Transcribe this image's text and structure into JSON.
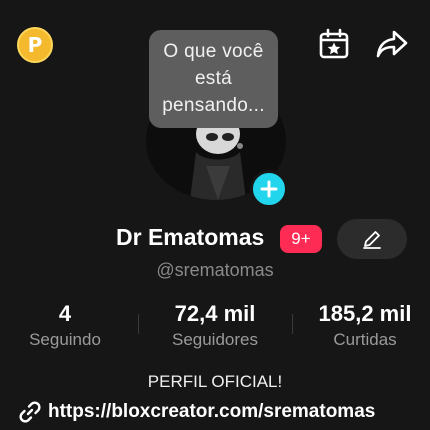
{
  "header": {
    "coin_letter": "P",
    "icons": [
      "coin-icon",
      "calendar-star-icon",
      "share-arrow-icon"
    ]
  },
  "avatar": {
    "note_bubble": "O que você está pensando...",
    "add_icon": "plus-icon"
  },
  "profile": {
    "display_name": "Dr Ematomas",
    "notification_badge": "9+",
    "username": "@srematomas",
    "edit_icon": "pencil-icon"
  },
  "stats": [
    {
      "value": "4",
      "label": "Seguindo"
    },
    {
      "value": "72,4 mil",
      "label": "Seguidores"
    },
    {
      "value": "185,2 mil",
      "label": "Curtidas"
    }
  ],
  "bio": {
    "text": "PERFIL OFICIAL!",
    "link": "https://bloxcreator.com/srematomas",
    "link_icon": "link-icon"
  },
  "colors": {
    "background": "#161616",
    "accent_cyan": "#20d5ec",
    "badge_red": "#fe2c55",
    "coin_gold": "#f4b92c",
    "bubble_gray": "#5e5e5e"
  }
}
